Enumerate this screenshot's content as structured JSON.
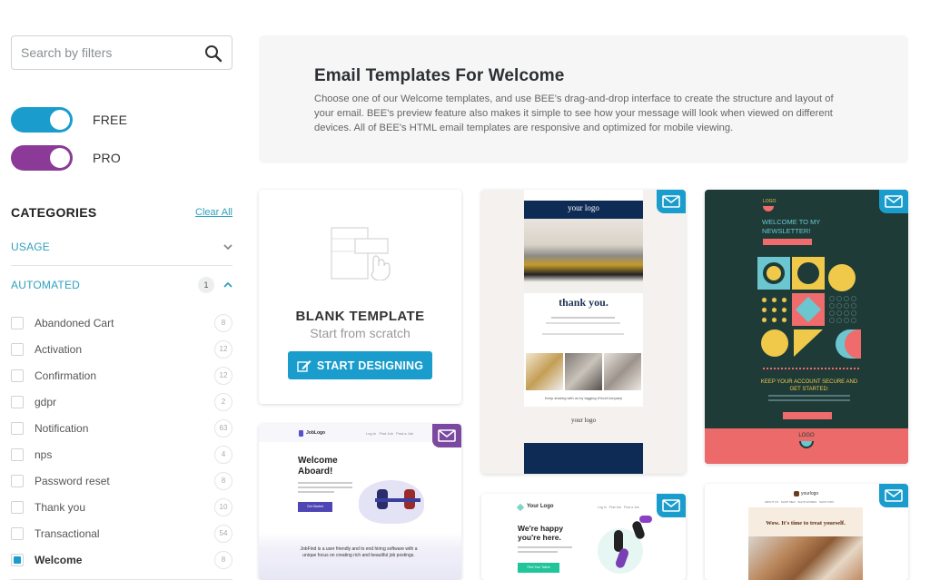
{
  "search": {
    "placeholder": "Search by filters",
    "value": ""
  },
  "toggles": [
    {
      "label": "FREE",
      "on": true,
      "color": "#1a9dcc"
    },
    {
      "label": "PRO",
      "on": true,
      "color": "#8b3a98"
    }
  ],
  "categories": {
    "title": "CATEGORIES",
    "clear_all": "Clear All",
    "sections": [
      {
        "title": "USAGE",
        "expanded": false
      },
      {
        "title": "AUTOMATED",
        "expanded": true,
        "selected_count": "1"
      }
    ],
    "items": [
      {
        "label": "Abandoned Cart",
        "count": "8",
        "checked": false
      },
      {
        "label": "Activation",
        "count": "12",
        "checked": false
      },
      {
        "label": "Confirmation",
        "count": "12",
        "checked": false
      },
      {
        "label": "gdpr",
        "count": "2",
        "checked": false
      },
      {
        "label": "Notification",
        "count": "63",
        "checked": false
      },
      {
        "label": "nps",
        "count": "4",
        "checked": false
      },
      {
        "label": "Password reset",
        "count": "8",
        "checked": false
      },
      {
        "label": "Thank you",
        "count": "10",
        "checked": false
      },
      {
        "label": "Transactional",
        "count": "54",
        "checked": false
      },
      {
        "label": "Welcome",
        "count": "8",
        "checked": true
      }
    ]
  },
  "hero": {
    "title": "Email Templates For Welcome",
    "description": "Choose one of our Welcome templates, and use BEE's drag-and-drop interface to create the structure and layout of your email. BEE's preview feature also makes it simple to see how your message will look when viewed on different devices. All of BEE's HTML email templates are responsive and optimized for mobile viewing."
  },
  "blank_card": {
    "title": "BLANK TEMPLATE",
    "subtitle": "Start from scratch",
    "button": "START DESIGNING"
  },
  "templates": [
    {
      "name": "hotel-thank-you",
      "tier": "free",
      "texts": {
        "logo": "your logo",
        "heading": "thank you.",
        "hashtag": "Keep sharing with us by tagging #YourCompany",
        "footer_logo": "your logo"
      }
    },
    {
      "name": "newsletter-welcome",
      "tier": "free",
      "texts": {
        "logo": "LOGO",
        "heading": "WELCOME TO MY NEWSLETTER!",
        "subheading": "KEEP YOUR ACCOUNT SECURE AND GET STARTED:",
        "footer_logo": "LOGO"
      }
    },
    {
      "name": "job-welcome-aboard",
      "tier": "pro",
      "texts": {
        "logo": "JobLogo",
        "nav": "Log In   Find Job   Post a Job",
        "heading": "Welcome Aboard!",
        "button": "Get Started",
        "body": "JobFind is a user friendly and to end hiring software with a unique focus on creating rich and beautiful job postings."
      }
    },
    {
      "name": "happy-youre-here",
      "tier": "free",
      "texts": {
        "logo": "Your Logo",
        "nav": "Log In   Find Job   Post a Job",
        "heading": "We're happy you're here.",
        "button": "Find Your Talent"
      }
    },
    {
      "name": "treat-yourself",
      "tier": "free",
      "texts": {
        "logo": "yourlogo",
        "nav": "ABOUT US   SHOP MEN   SHOP WOMEN   SHOP KIDS",
        "heading": "Wow. It's time to treat yourself."
      }
    }
  ],
  "colors": {
    "free_badge": "#1a9dcc",
    "pro_badge": "#7b4aa0",
    "accent": "#2fa0c0"
  }
}
